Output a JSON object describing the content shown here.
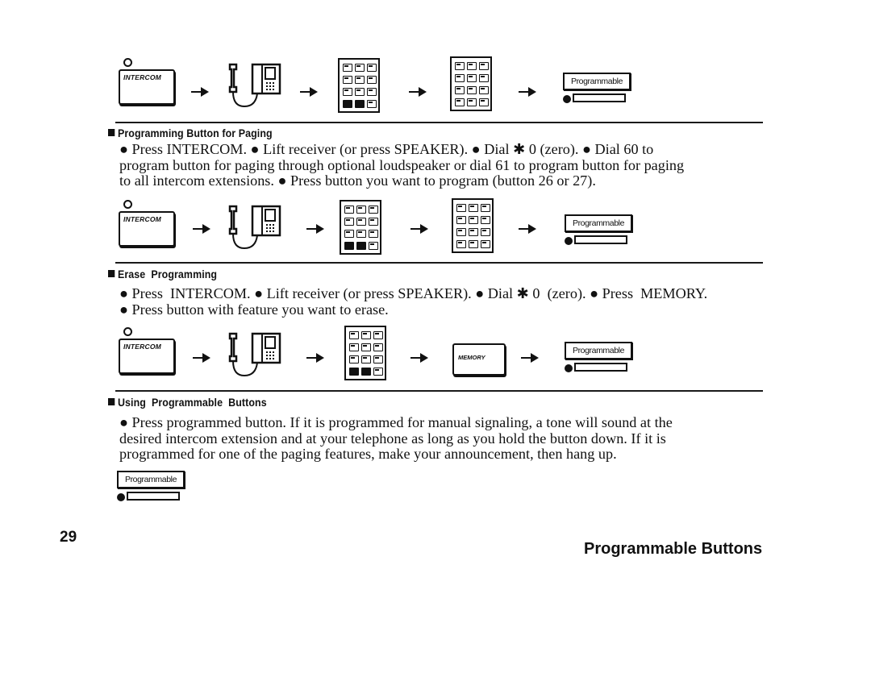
{
  "page": {
    "number": "29",
    "title": "Programmable Buttons"
  },
  "labels": {
    "intercom": "INTERCOM",
    "memory": "MEMORY",
    "programmable": "Programmable"
  },
  "sections": [
    {
      "heading": "Programming Button for Paging",
      "lines": [
        "● Press INTERCOM. ● Lift receiver (or press SPEAKER). ● Dial ✱ 0 (zero). ● Dial 60 to",
        "program button for paging through optional loudspeaker or dial 61 to program button for paging",
        "to all intercom extensions. ● Press button you want to program (button 26 or 27)."
      ]
    },
    {
      "heading": "Erase  Programming",
      "lines": [
        "● Press  INTERCOM. ● Lift receiver (or press SPEAKER). ● Dial ✱ 0  (zero). ● Press  MEMORY.",
        "● Press button with feature you want to erase."
      ]
    },
    {
      "heading": "Using  Programmable  Buttons",
      "lines": [
        "● Press programmed button. If it is programmed for manual signaling, a tone will sound at the",
        "desired intercom extension and at your telephone as long as you hold the button down. If it is",
        "programmed for one of the paging features, make your announcement, then hang up."
      ]
    }
  ],
  "flows": [
    {
      "steps": [
        "intercom-button",
        "lift-receiver",
        "dial-keypad-star",
        "dial-keypad-digits",
        "programmable-button"
      ]
    },
    {
      "steps": [
        "intercom-button",
        "lift-receiver",
        "dial-keypad-star",
        "dial-keypad-digits",
        "programmable-button"
      ]
    },
    {
      "steps": [
        "intercom-button",
        "lift-receiver",
        "dial-keypad-star",
        "memory-button",
        "programmable-button"
      ]
    }
  ]
}
